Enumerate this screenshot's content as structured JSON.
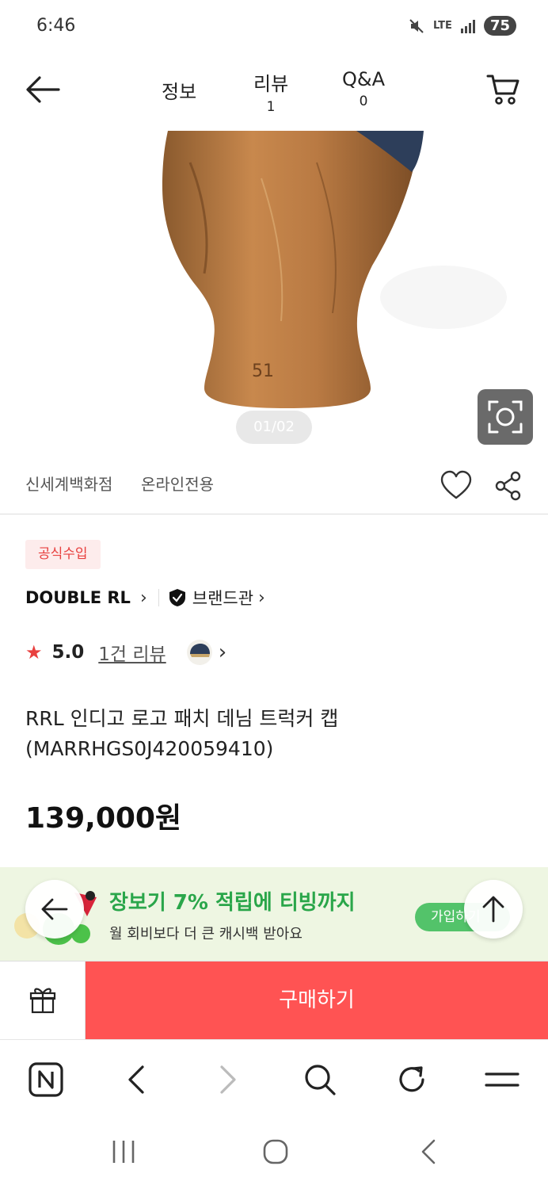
{
  "status_bar": {
    "time": "6:46",
    "network": "LTE",
    "battery": "75"
  },
  "topbar": {
    "tabs": [
      {
        "label": "정보",
        "count": ""
      },
      {
        "label": "리뷰",
        "count": "1"
      },
      {
        "label": "Q&A",
        "count": "0"
      }
    ]
  },
  "gallery": {
    "indicator": "01/02"
  },
  "store": {
    "department": "신세계백화점",
    "channel": "온라인전용"
  },
  "product": {
    "badge": "공식수입",
    "brand": "DOUBLE RL",
    "brand_hall": "브랜드관",
    "rating": "5.0",
    "review_count": "1건 리뷰",
    "title": "RRL 인디고 로고 패치 데님 트럭커 캡(MARRHGS0J420059410)",
    "price": "139,000원"
  },
  "banner": {
    "title": "장보기 7% 적립에 티빙까지",
    "subtitle": "월 회비보다 더 큰 캐시백 받아요",
    "join_label": "가입하기"
  },
  "buy_bar": {
    "buy_label": "구매하기"
  },
  "colors": {
    "accent": "#ff5353",
    "badge_text": "#e8403f",
    "banner_green": "#2aa64a"
  },
  "icons": [
    "back-arrow-icon",
    "cart-icon",
    "lens-icon",
    "heart-icon",
    "share-icon",
    "shield-icon",
    "star-icon",
    "gift-icon",
    "naver-icon",
    "search-icon",
    "refresh-icon",
    "menu-icon"
  ]
}
